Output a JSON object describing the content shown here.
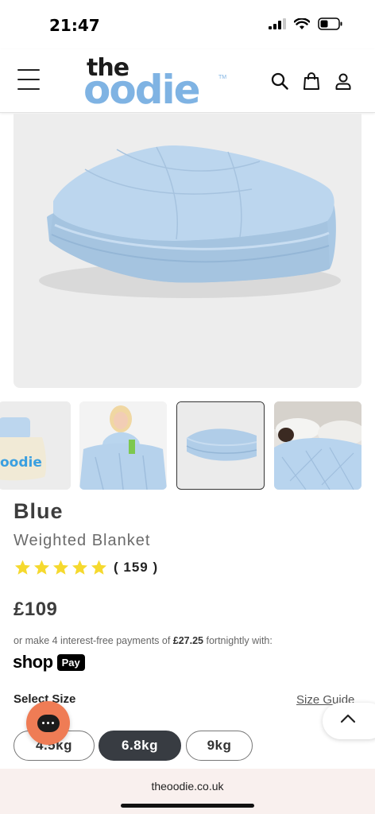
{
  "status_bar": {
    "time": "21:47"
  },
  "header": {
    "logo": {
      "the": "the",
      "oodie": "oodie",
      "tm": "TM"
    },
    "icons": [
      "menu-icon",
      "search-icon",
      "shopping-bag-icon",
      "user-icon"
    ]
  },
  "product": {
    "name": "Blue",
    "subtitle": "Weighted Blanket",
    "rating_stars": 5,
    "review_count": "( 159 )",
    "price": "£109",
    "installment": {
      "prefix": "or make 4 interest-free payments of ",
      "amount": "£27.25",
      "suffix": " fortnightly with:"
    },
    "shop_pay": {
      "shop": "shop",
      "pay": "Pay"
    }
  },
  "thumbnails": [
    {
      "alt": "Oodie weighted blanket package",
      "label": "oodie"
    },
    {
      "alt": "Woman under blue weighted blanket"
    },
    {
      "alt": "Folded blue weighted blanket",
      "selected": true
    },
    {
      "alt": "Person sleeping under blue weighted blanket"
    }
  ],
  "size_selector": {
    "label": "Select Size",
    "guide_label": "Size Guide",
    "options": [
      "4.5kg",
      "6.8kg",
      "9kg"
    ],
    "selected": "6.8kg"
  },
  "browser": {
    "url": "theoodie.co.uk"
  },
  "colors": {
    "brand_blue": "#7fb3e3",
    "star_yellow": "#f5d92e",
    "selected_dark": "#383c42",
    "chat_orange": "#ef7c55"
  }
}
